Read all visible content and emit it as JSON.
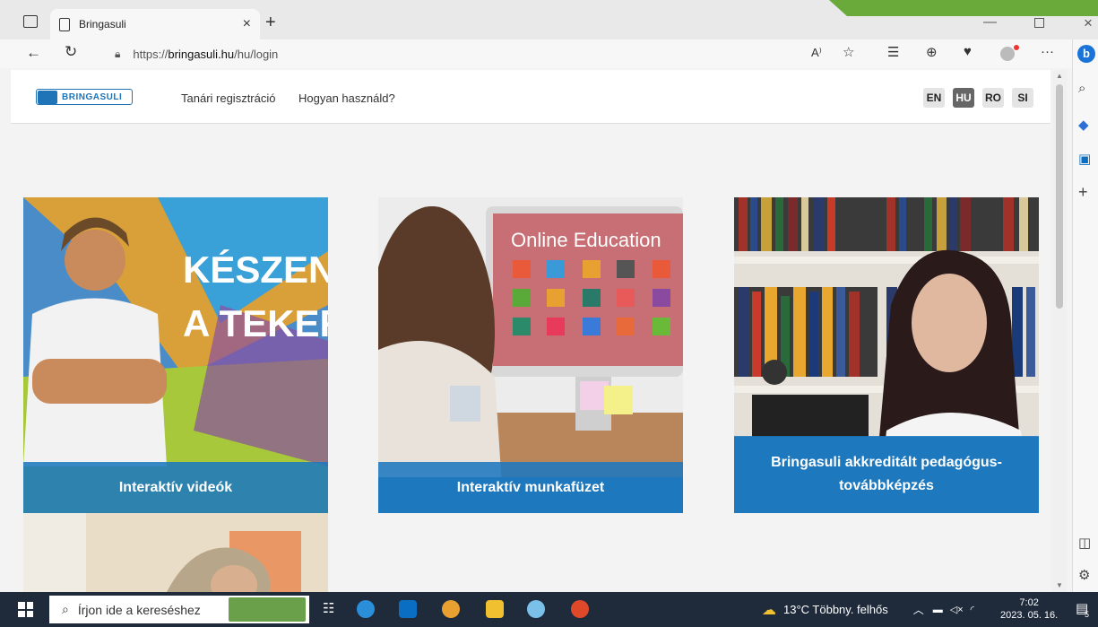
{
  "browser": {
    "tab_title": "Bringasuli",
    "url_prefix": "https://",
    "url_host": "bringasuli.hu",
    "url_path": "/hu/login",
    "read_aloud_icon": "A⁾"
  },
  "site": {
    "logo_text": "BRINGASULI",
    "nav": [
      "Tanári regisztráció",
      "Hogyan használd?"
    ],
    "languages": [
      "EN",
      "HU",
      "RO",
      "SI"
    ],
    "active_language": "HU"
  },
  "cards": [
    {
      "caption": "Interaktív videók",
      "image_text_1": "KÉSZEN Á",
      "image_text_2": "A TEKERÉ"
    },
    {
      "caption": "Interaktív munkafüzet",
      "image_text_1": "Online Education"
    },
    {
      "caption_line1": "Bringasuli akkreditált pedagógus-",
      "caption_line2": "továbbképzés"
    }
  ],
  "taskbar": {
    "search_placeholder": "Írjon ide a kereséshez",
    "weather": "13°C  Többny. felhős",
    "time": "7:02",
    "date": "2023. 05. 16.",
    "notification_count": "5"
  },
  "colors": {
    "brand": "#1f73b7",
    "caption": "#1e78be"
  }
}
